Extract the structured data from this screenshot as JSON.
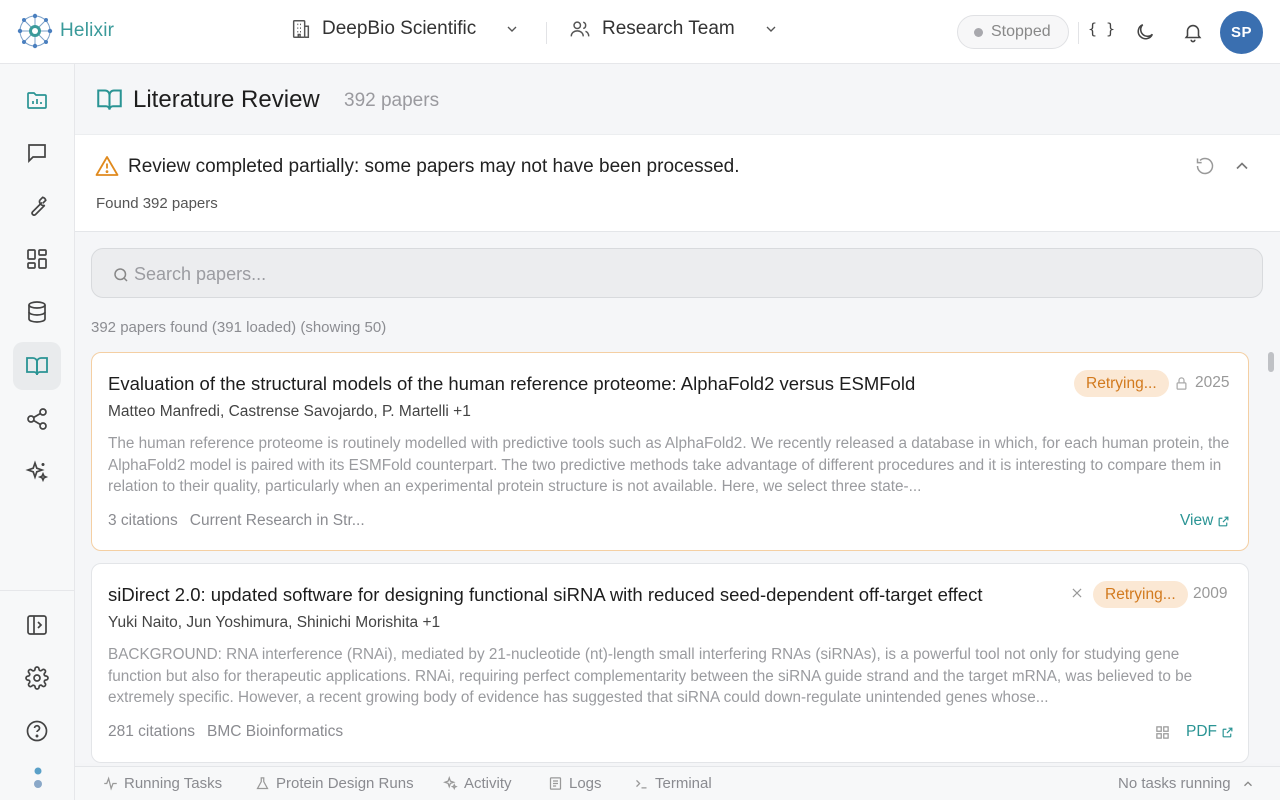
{
  "brand": {
    "name": "Helixir",
    "accent": "#3a9a9a"
  },
  "header": {
    "organization": "DeepBio Scientific",
    "team": "Research Team",
    "status": "Stopped",
    "json_label": "{ }",
    "avatar_initials": "SP"
  },
  "sidebar": {
    "items": [
      {
        "name": "dashboard",
        "icon": "folder-chart-icon",
        "active": false
      },
      {
        "name": "chat",
        "icon": "chat-icon",
        "active": false
      },
      {
        "name": "tools",
        "icon": "wrench-icon",
        "active": false
      },
      {
        "name": "apps",
        "icon": "grid-icon",
        "active": false
      },
      {
        "name": "database",
        "icon": "database-icon",
        "active": false
      },
      {
        "name": "literature",
        "icon": "book-icon",
        "active": true
      },
      {
        "name": "share",
        "icon": "share-icon",
        "active": false
      },
      {
        "name": "ai",
        "icon": "sparkles-icon",
        "active": false
      }
    ],
    "bottom": [
      {
        "name": "toggle-panel",
        "icon": "panel-icon"
      },
      {
        "name": "settings",
        "icon": "gear-icon"
      },
      {
        "name": "help",
        "icon": "help-icon"
      }
    ]
  },
  "page": {
    "title": "Literature Review",
    "count": "392 papers"
  },
  "notice": {
    "title": "Review completed partially: some papers may not have been processed.",
    "subtitle": "Found 392 papers"
  },
  "search": {
    "placeholder": "Search papers..."
  },
  "results_summary": "392 papers found (391 loaded) (showing 50)",
  "papers": [
    {
      "title": "Evaluation of the structural models of the human reference proteome: AlphaFold2 versus ESMFold",
      "status": "Retrying...",
      "year": "2025",
      "authors": "Matteo Manfredi, Castrense Savojardo, P. Martelli +1",
      "abstract": "The human reference proteome is routinely modelled with predictive tools such as AlphaFold2. We recently released a database in which, for each human protein, the AlphaFold2 model is paired with its ESMFold counterpart. The two predictive methods take advantage of different procedures and it is interesting to compare them in relation to their quality, particularly when an experimental protein structure is not available. Here, we select three state-...",
      "citations": "3 citations",
      "journal": "Current Research in Str...",
      "link": "View"
    },
    {
      "title": "siDirect 2.0: updated software for designing functional siRNA with reduced seed-dependent off-target effect",
      "status": "Retrying...",
      "year": "2009",
      "authors": "Yuki Naito, Jun Yoshimura, Shinichi Morishita +1",
      "abstract": "BACKGROUND: RNA interference (RNAi), mediated by 21-nucleotide (nt)-length small interfering RNAs (siRNAs), is a powerful tool not only for studying gene function but also for therapeutic applications. RNAi, requiring perfect complementarity between the siRNA guide strand and the target mRNA, was believed to be extremely specific. However, a recent growing body of evidence has suggested that siRNA could down-regulate unintended genes whose...",
      "citations": "281 citations",
      "journal": "BMC Bioinformatics",
      "link": "PDF"
    }
  ],
  "bottombar": {
    "tabs": [
      "Running Tasks",
      "Protein Design Runs",
      "Activity",
      "Logs",
      "Terminal"
    ],
    "status": "No tasks running"
  },
  "colors": {
    "badge_bg": "#fbe8d4",
    "badge_text": "#d27a1e",
    "warning": "#e08a1e",
    "link": "#2a9494"
  }
}
